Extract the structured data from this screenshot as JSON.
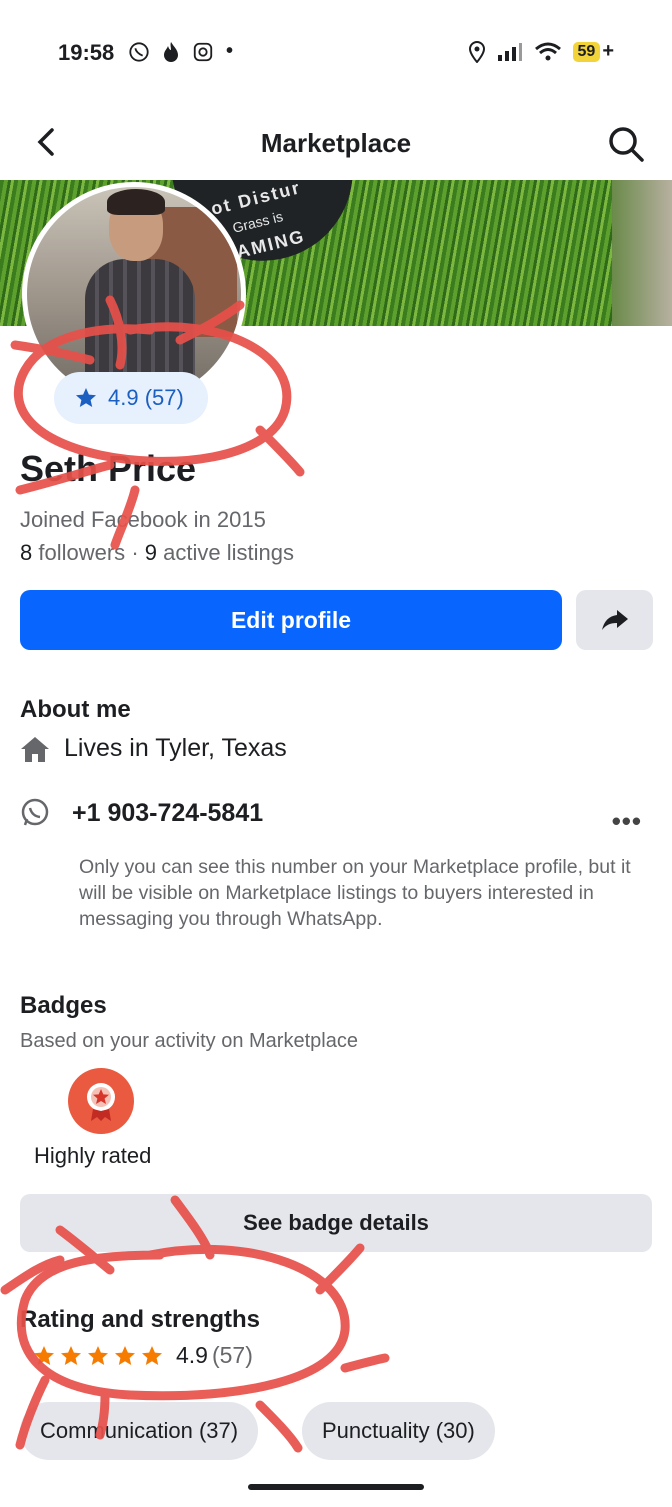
{
  "status_bar": {
    "time": "19:58",
    "battery": "59",
    "charging": "+"
  },
  "nav": {
    "title": "Marketplace"
  },
  "cover": {
    "sign_line1": "ot Distur",
    "sign_line2": "Grass is",
    "sign_line3": "AMING"
  },
  "profile": {
    "rating_pill": "4.9 (57)",
    "name": "Seth Price",
    "joined": "Joined Facebook in 2015",
    "followers_count": "8",
    "followers_label": "followers",
    "listings_count": "9",
    "listings_label": "active listings",
    "edit_label": "Edit profile"
  },
  "about": {
    "heading": "About me",
    "lives": "Lives in Tyler, Texas",
    "phone": "+1 903-724-5841",
    "phone_note": "Only you can see this number on your Marketplace profile, but it will be visible on Marketplace listings to buyers interested in messaging you through WhatsApp."
  },
  "badges": {
    "heading": "Badges",
    "subtitle": "Based on your activity on Marketplace",
    "badge_label": "Highly rated",
    "see_details": "See badge details"
  },
  "ratings": {
    "heading": "Rating and strengths",
    "score": "4.9",
    "count": "(57)",
    "stars": 5,
    "chips": [
      {
        "label": "Communication (37)"
      },
      {
        "label": "Punctuality (30)"
      }
    ]
  },
  "colors": {
    "accent": "#0866ff",
    "star": "#f57c00",
    "annotation": "#e8504a",
    "badge": "#ea5a40"
  }
}
